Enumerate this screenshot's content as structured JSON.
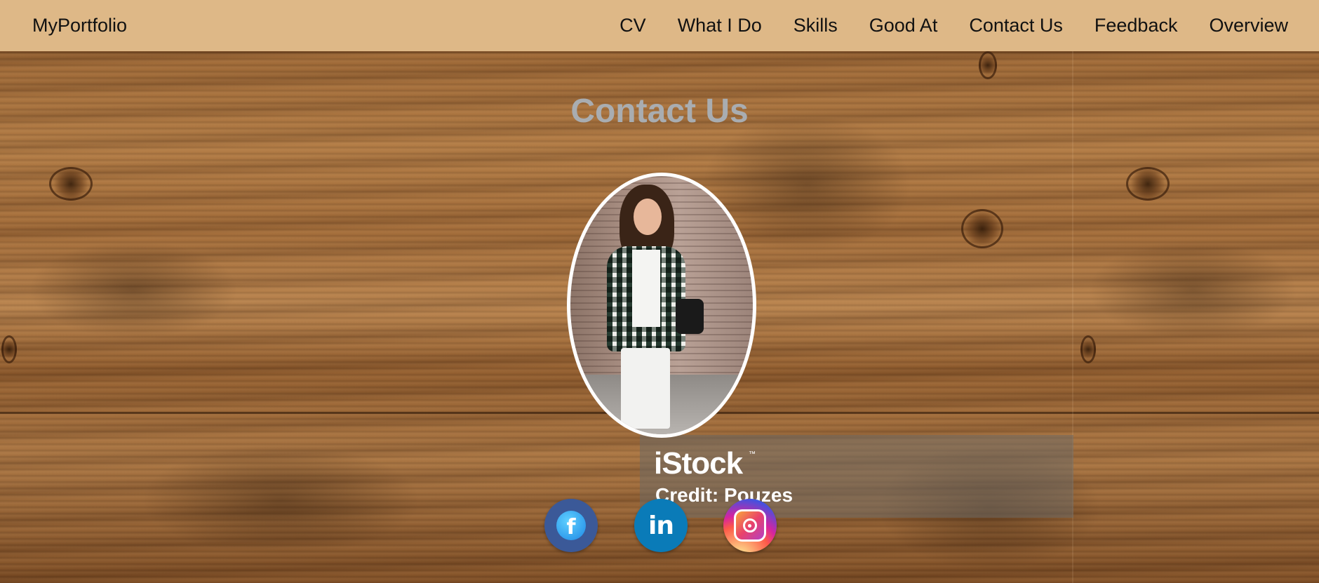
{
  "navbar": {
    "brand": "MyPortfolio",
    "links": [
      {
        "label": "CV"
      },
      {
        "label": "What I Do"
      },
      {
        "label": "Skills"
      },
      {
        "label": "Good At"
      },
      {
        "label": "Contact Us"
      },
      {
        "label": "Feedback"
      },
      {
        "label": "Overview"
      }
    ],
    "background_color": "#deb887"
  },
  "main": {
    "heading": "Contact Us",
    "heading_color": "#a9adb1",
    "watermark": {
      "brand": "iStock",
      "trademark": "™",
      "credit": "Credit: Pouzes"
    },
    "socials": [
      {
        "name": "facebook",
        "icon": "facebook-icon",
        "glyph": "f"
      },
      {
        "name": "linkedin",
        "icon": "linkedin-icon",
        "glyph": "in"
      },
      {
        "name": "instagram",
        "icon": "instagram-icon"
      }
    ]
  }
}
